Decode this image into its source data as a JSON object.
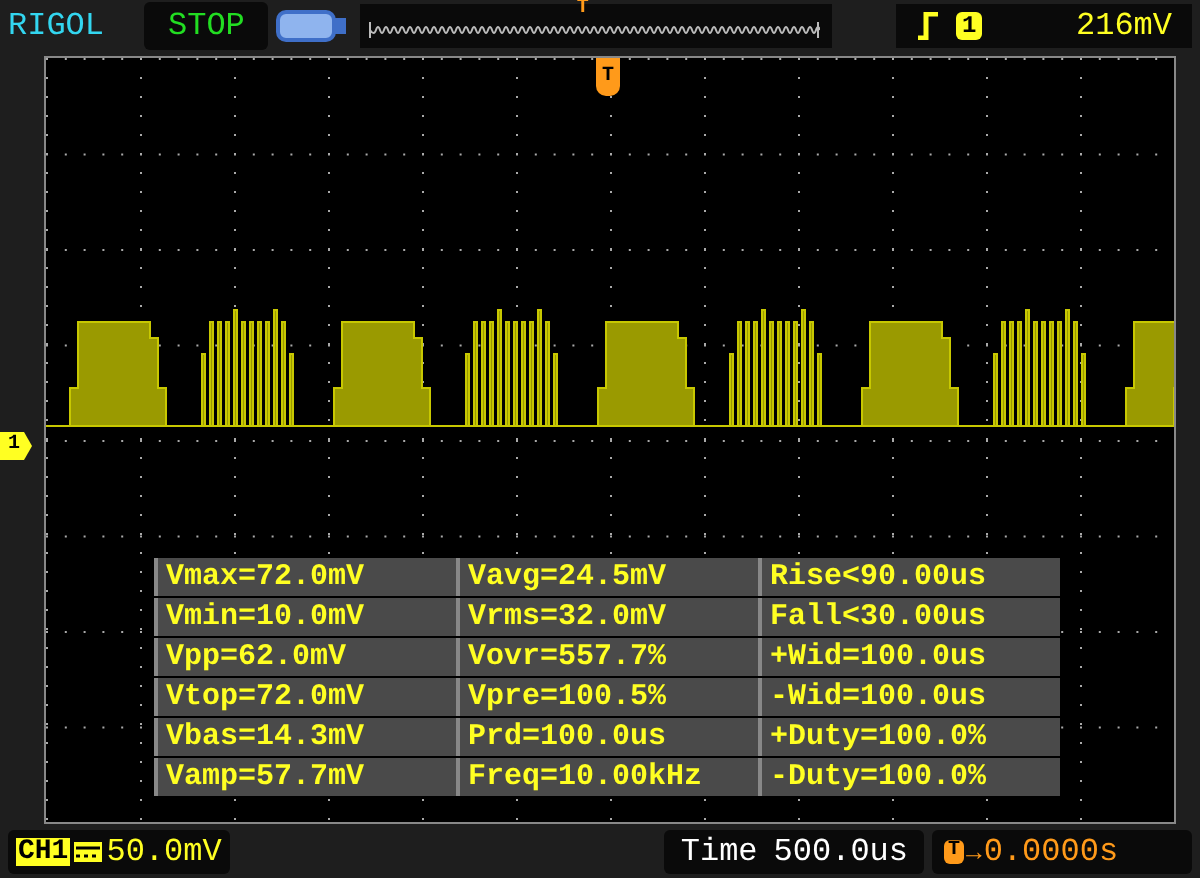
{
  "header": {
    "brand": "RIGOL",
    "run_state": "STOP",
    "memory_trigger_marker": "T",
    "trigger": {
      "channel": "1",
      "level": "216mV"
    }
  },
  "plot": {
    "trigger_marker": "T",
    "channel_marker": "1"
  },
  "measurements": [
    [
      "Vmax=72.0mV",
      "Vavg=24.5mV",
      "Rise<90.00us"
    ],
    [
      "Vmin=10.0mV",
      "Vrms=32.0mV",
      "Fall<30.00us"
    ],
    [
      "Vpp=62.0mV",
      "Vovr=557.7%",
      "+Wid=100.0us"
    ],
    [
      "Vtop=72.0mV",
      "Vpre=100.5%",
      "-Wid=100.0us"
    ],
    [
      "Vbas=14.3mV",
      "Prd=100.0us",
      "+Duty=100.0%"
    ],
    [
      "Vamp=57.7mV",
      "Freq=10.00kHz",
      "-Duty=100.0%"
    ]
  ],
  "footer": {
    "channel": "CH1",
    "scale": "50.0mV",
    "time_label": "Time",
    "time_scale": "500.0us",
    "offset_marker": "T",
    "offset_arrow": "→",
    "offset": "0.0000s"
  }
}
